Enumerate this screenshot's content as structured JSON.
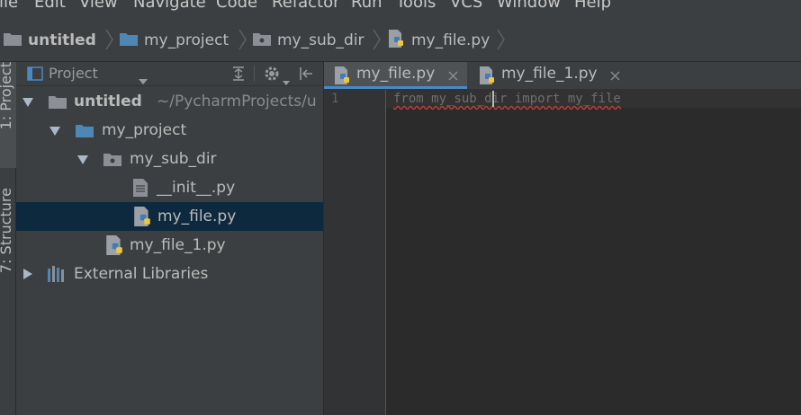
{
  "menu": [
    "File",
    "Edit",
    "View",
    "Navigate",
    "Code",
    "Refactor",
    "Run",
    "Tools",
    "VCS",
    "Window",
    "Help"
  ],
  "breadcrumb": [
    "untitled",
    "my_project",
    "my_sub_dir",
    "my_file.py"
  ],
  "side_tabs": {
    "project": "1: Project",
    "structure": "7: Structure"
  },
  "project_panel": {
    "title": "Project",
    "tree": {
      "root_label": "untitled",
      "root_path": "~/PycharmProjects/u",
      "my_project": "my_project",
      "my_sub_dir": "my_sub_dir",
      "init_file": "__init__.py",
      "my_file": "my_file.py",
      "my_file_1": "my_file_1.py",
      "external": "External Libraries"
    }
  },
  "tabs": [
    {
      "label": "my_file.py",
      "active": true
    },
    {
      "label": "my_file_1.py",
      "active": false
    }
  ],
  "editor": {
    "line_number": "1",
    "code": "from my_sub_dir import my_file"
  },
  "colors": {
    "background": "#3c3f41",
    "editor_background": "#2b2b2b",
    "selection": "#0d293e",
    "folder_blue": "#4f87b4",
    "tab_underline": "#4a88c7",
    "error_underline": "#bc3f3c"
  }
}
